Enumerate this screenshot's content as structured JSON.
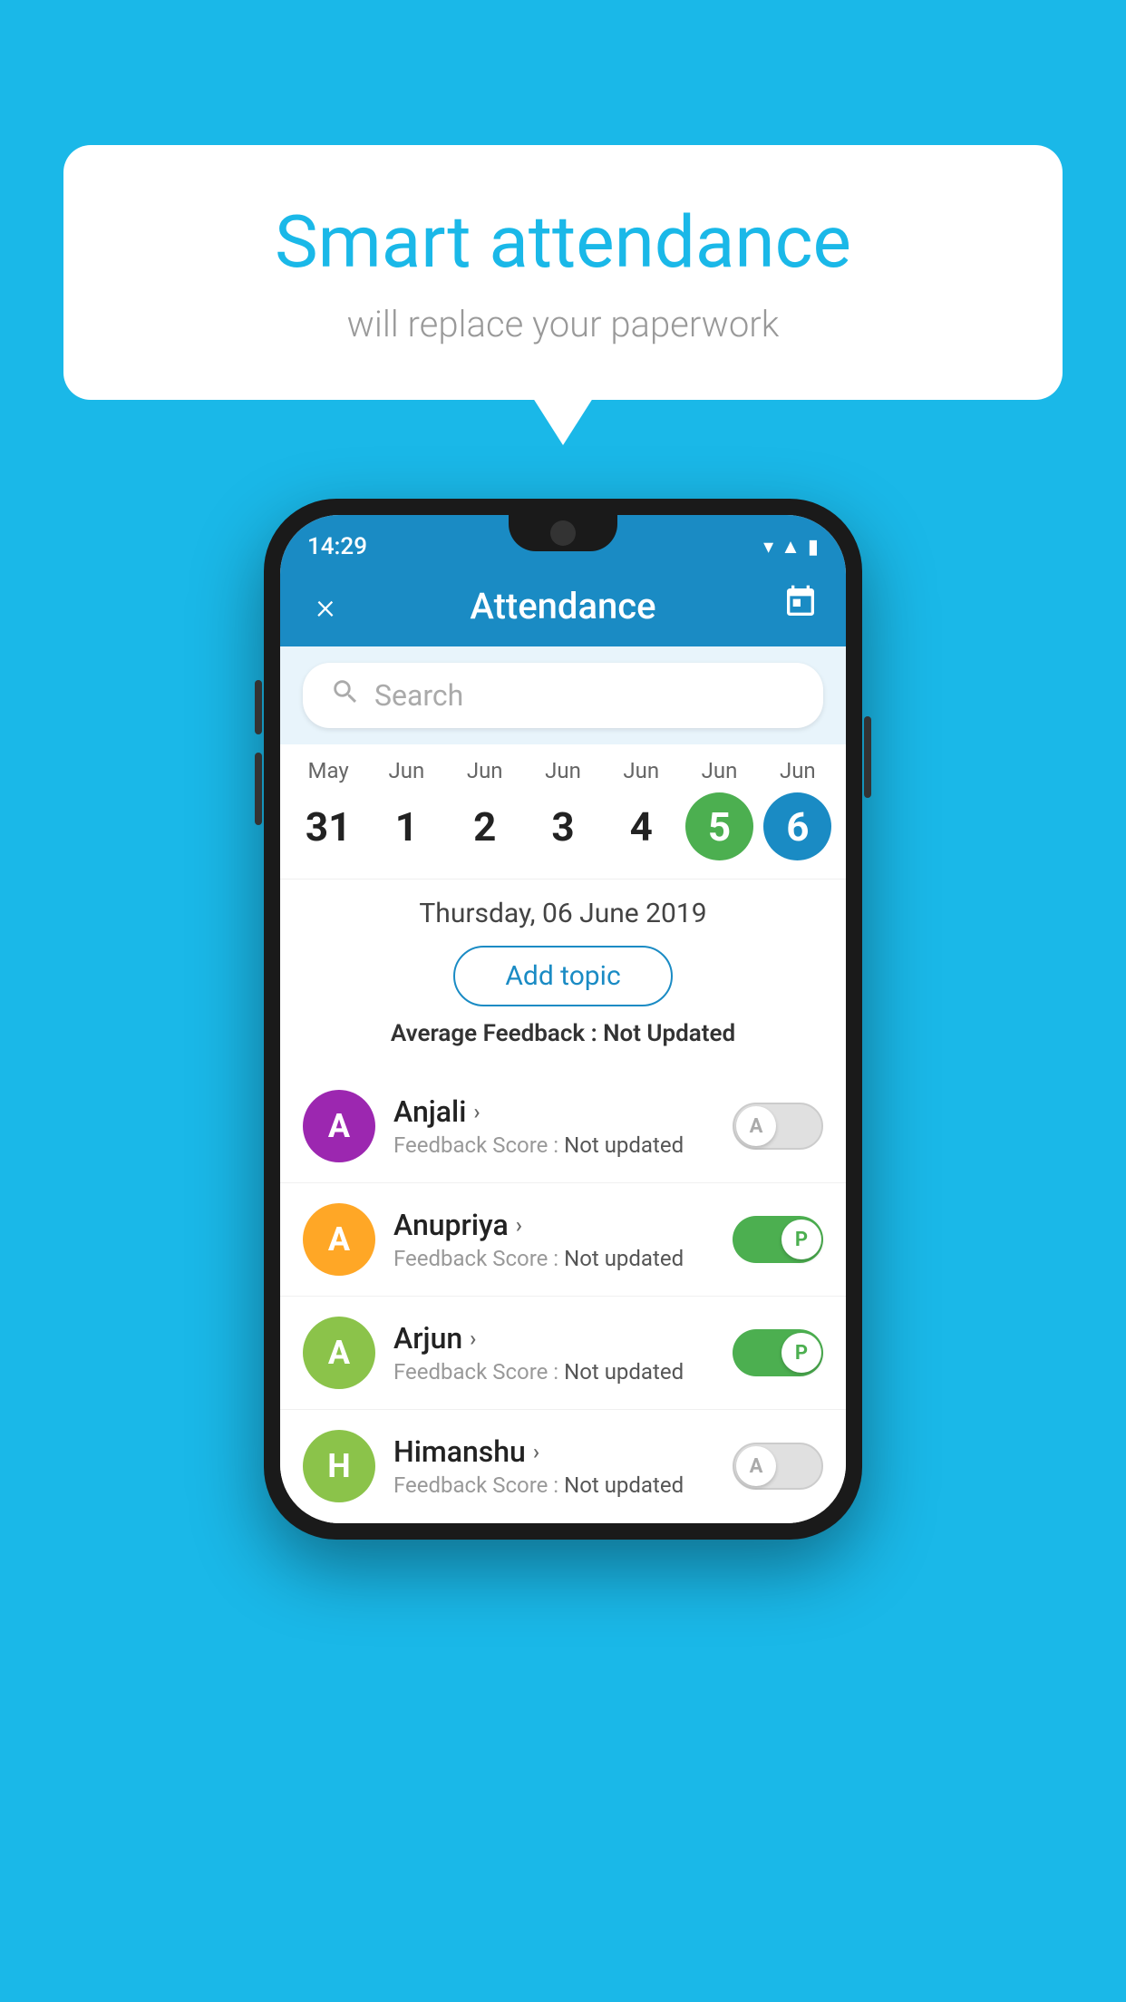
{
  "background_color": "#1ab8e8",
  "bubble": {
    "title": "Smart attendance",
    "subtitle": "will replace your paperwork"
  },
  "phone": {
    "status_bar": {
      "time": "14:29",
      "icons": [
        "wifi",
        "signal",
        "battery"
      ]
    },
    "app_bar": {
      "title": "Attendance",
      "close_label": "×",
      "calendar_label": "📅"
    },
    "search": {
      "placeholder": "Search"
    },
    "calendar": {
      "days": [
        {
          "month": "May",
          "number": "31",
          "state": "normal"
        },
        {
          "month": "Jun",
          "number": "1",
          "state": "normal"
        },
        {
          "month": "Jun",
          "number": "2",
          "state": "normal"
        },
        {
          "month": "Jun",
          "number": "3",
          "state": "normal"
        },
        {
          "month": "Jun",
          "number": "4",
          "state": "normal"
        },
        {
          "month": "Jun",
          "number": "5",
          "state": "today"
        },
        {
          "month": "Jun",
          "number": "6",
          "state": "selected"
        }
      ]
    },
    "selected_date": "Thursday, 06 June 2019",
    "add_topic_label": "Add topic",
    "avg_feedback_label": "Average Feedback :",
    "avg_feedback_value": "Not Updated",
    "students": [
      {
        "name": "Anjali",
        "initial": "A",
        "avatar_color": "#9c27b0",
        "feedback_label": "Feedback Score :",
        "feedback_value": "Not updated",
        "toggle": "off",
        "toggle_letter": "A"
      },
      {
        "name": "Anupriya",
        "initial": "A",
        "avatar_color": "#ffa726",
        "feedback_label": "Feedback Score :",
        "feedback_value": "Not updated",
        "toggle": "on",
        "toggle_letter": "P"
      },
      {
        "name": "Arjun",
        "initial": "A",
        "avatar_color": "#8bc34a",
        "feedback_label": "Feedback Score :",
        "feedback_value": "Not updated",
        "toggle": "on",
        "toggle_letter": "P"
      },
      {
        "name": "Himanshu",
        "initial": "H",
        "avatar_color": "#8bc34a",
        "feedback_label": "Feedback Score :",
        "feedback_value": "Not updated",
        "toggle": "off",
        "toggle_letter": "A"
      }
    ]
  }
}
